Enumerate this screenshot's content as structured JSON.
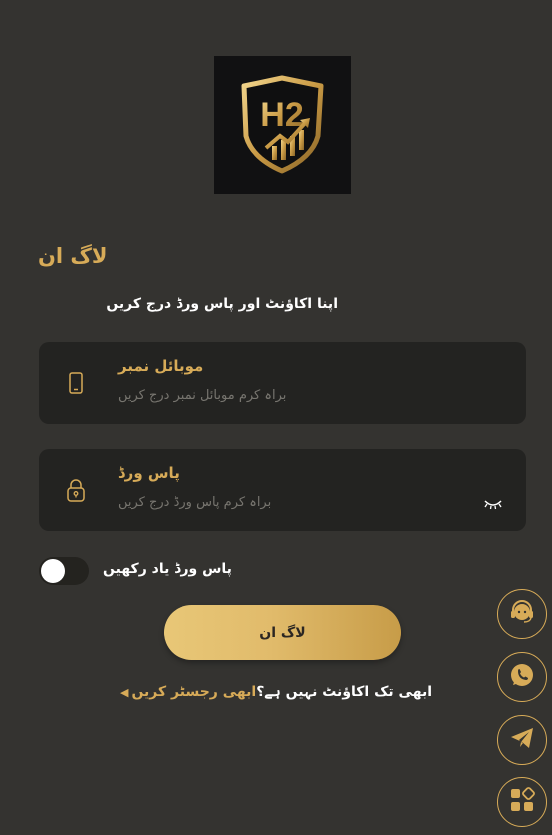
{
  "logo": {
    "text": "H2"
  },
  "login": {
    "title": "لاگ ان",
    "subtitle": "اپنا اکاؤنٹ اور پاس ورڈ درج کریں"
  },
  "mobile_field": {
    "label": "موبائل نمبر",
    "placeholder": "براہ کرم موبائل نمبر درج کریں",
    "icon": "phone-icon"
  },
  "password_field": {
    "label": "پاس ورڈ",
    "placeholder": "براہ کرم پاس ورڈ درج کریں",
    "icon": "lock-icon",
    "toggle_icon": "eye-closed-icon"
  },
  "remember": {
    "label": "پاس ورڈ یاد رکھیں",
    "checked": false
  },
  "login_button": {
    "label": "لاگ ان"
  },
  "register": {
    "question": "ابھی تک اکاؤنٹ نہیں ہے؟",
    "link": "ابھی رجسٹر کریں"
  },
  "floating_buttons": [
    {
      "icon": "customer-support-icon"
    },
    {
      "icon": "whatsapp-icon"
    },
    {
      "icon": "telegram-icon"
    },
    {
      "icon": "apps-icon"
    }
  ],
  "colors": {
    "background": "#343330",
    "field_bg": "#232321",
    "accent_gold": "#d7ab58",
    "button_gradient_start": "#e8c777",
    "button_gradient_end": "#c79c48"
  }
}
